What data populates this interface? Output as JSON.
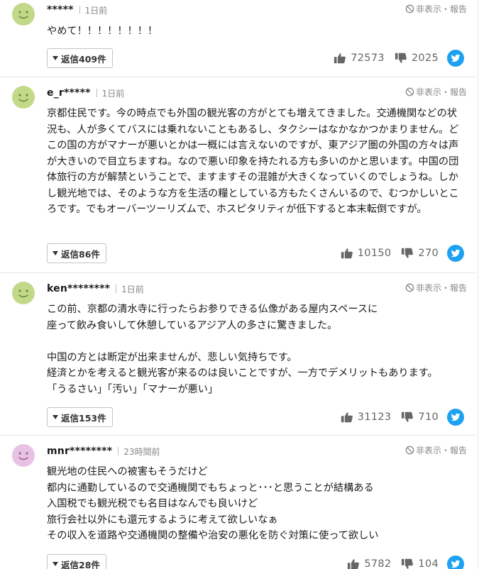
{
  "ui": {
    "hide_report_label": "非表示・報告"
  },
  "comments": [
    {
      "username": "*****",
      "time": "1日前",
      "body": "やめて！！！！！！！！",
      "reply_label": "返信409件",
      "likes": "72573",
      "dislikes": "2025",
      "avatar_color": "#c3d98a"
    },
    {
      "username": "e_r*****",
      "time": "1日前",
      "body": "京都住民です。今の時点でも外国の観光客の方がとても増えてきました。交通機関などの状況も、人が多くてバスには乗れないこともあるし、タクシーはなかなかつかまりません。どこの国の方がマナーが悪いとかは一概には言えないのですが、東アジア圏の外国の方々は声が大きいので目立ちますね。なので悪い印象を持たれる方も多いのかと思います。中国の団体旅行の方が解禁ということで、ますますその混雑が大きくなっていくのでしょうね。しかし観光地では、そのような方を生活の糧としている方もたくさんいるので、むつかしいところです。でもオーバーツーリズムで、ホスピタリティが低下すると本末転倒ですが。",
      "reply_label": "返信86件",
      "likes": "10150",
      "dislikes": "270",
      "avatar_color": "#c3d98a"
    },
    {
      "username": "ken********",
      "time": "1日前",
      "body": "この前、京都の清水寺に行ったらお参りできる仏像がある屋内スペースに\n座って飲み食いして休憩しているアジア人の多さに驚きました。\n\n中国の方とは断定が出来ませんが、悲しい気持ちです。\n経済とかを考えると観光客が来るのは良いことですが、一方でデメリットもあります。\n「うるさい」「汚い」「マナーが悪い」",
      "reply_label": "返信153件",
      "likes": "31123",
      "dislikes": "710",
      "avatar_color": "#c3d98a"
    },
    {
      "username": "mnr********",
      "time": "23時間前",
      "body": "観光地の住民への被害もそうだけど\n都内に通勤しているので交通機関でもちょっと･･･と思うことが結構ある\n入国税でも観光税でも名目はなんでも良いけど\n旅行会社以外にも還元するように考えて欲しいなぁ\nその収入を道路や交通機関の整備や治安の悪化を防ぐ対策に使って欲しい",
      "reply_label": "返信28件",
      "likes": "5782",
      "dislikes": "104",
      "avatar_color": "#e7c2e4"
    }
  ]
}
